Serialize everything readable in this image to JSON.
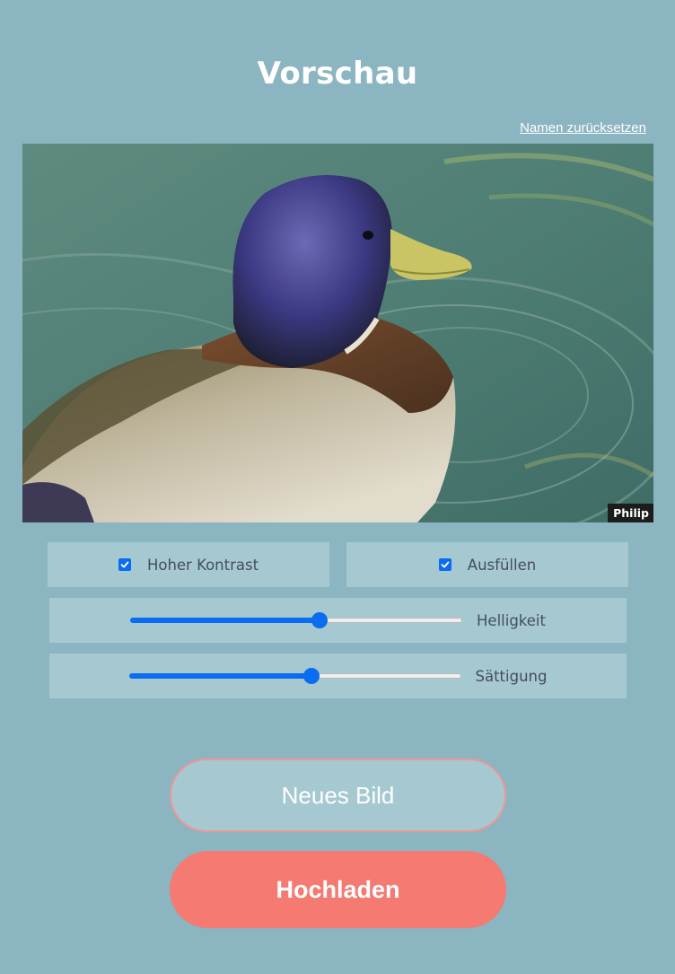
{
  "header": {
    "title": "Vorschau",
    "reset_link": "Namen zurücksetzen"
  },
  "preview": {
    "name_tag": "Philip"
  },
  "options": {
    "high_contrast": {
      "label": "Hoher Kontrast",
      "checked": true
    },
    "fill": {
      "label": "Ausfüllen",
      "checked": true
    }
  },
  "sliders": {
    "brightness": {
      "label": "Helligkeit",
      "value": 0.57
    },
    "saturation": {
      "label": "Sättigung",
      "value": 0.55
    }
  },
  "buttons": {
    "new_image": "Neues Bild",
    "upload": "Hochladen"
  },
  "colors": {
    "background": "#8bb5c1",
    "panel": "#a6c9d1",
    "accent": "#0a6cf0",
    "upload_button": "#f47a72",
    "new_image_border": "#ef9696"
  }
}
